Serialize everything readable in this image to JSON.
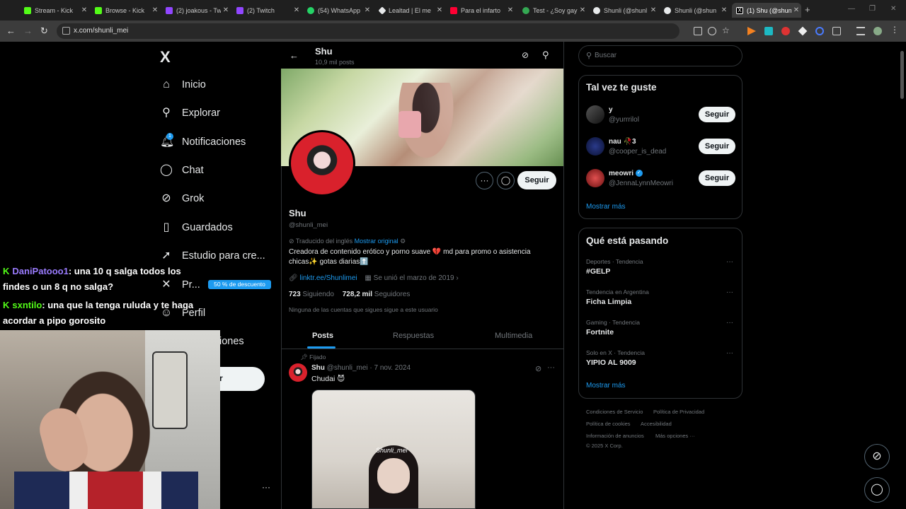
{
  "browser": {
    "tabs": [
      {
        "title": "Stream - Kick",
        "color": "#53fc18"
      },
      {
        "title": "Browse - Kick",
        "color": "#53fc18"
      },
      {
        "title": "(2) joakous - Tw",
        "color": "#9146ff"
      },
      {
        "title": "(2) Twitch",
        "color": "#9146ff"
      },
      {
        "title": "(54) WhatsApp",
        "color": "#25d366"
      },
      {
        "title": "Lealtad | El me",
        "color": "#e7e9ea"
      },
      {
        "title": "Para el infarto",
        "color": "#ff0033"
      },
      {
        "title": "Test - ¿Soy gay",
        "color": "#34a853"
      },
      {
        "title": "Shunli (@shunl",
        "color": "#e7e9ea"
      },
      {
        "title": "Shunli (@shun",
        "color": "#e7e9ea"
      },
      {
        "title": "(1) Shu (@shun",
        "color": "#e7e9ea"
      }
    ],
    "url": "x.com/shunli_mei"
  },
  "sidebar": {
    "logo": "X",
    "items": [
      {
        "label": "Inicio",
        "icon": "home-icon"
      },
      {
        "label": "Explorar",
        "icon": "search-icon"
      },
      {
        "label": "Notificaciones",
        "icon": "bell-icon",
        "badge": "1"
      },
      {
        "label": "Chat",
        "icon": "chat-icon"
      },
      {
        "label": "Grok",
        "icon": "grok-icon"
      },
      {
        "label": "Guardados",
        "icon": "bookmark-icon"
      },
      {
        "label": "Estudio para cre...",
        "icon": "rocket-icon"
      },
      {
        "label": "Pr...",
        "icon": "x-premium-icon"
      },
      {
        "label": "Perfil",
        "icon": "person-icon"
      },
      {
        "label": "iones",
        "icon": "more-icon"
      }
    ],
    "premium_badge": "50 % de descuento",
    "post_button": "r"
  },
  "profile": {
    "header_name": "Shu",
    "header_count": "10,9 mil posts",
    "name": "Shu",
    "handle": "@shunli_mei",
    "follow_label": "Seguir",
    "translated_label": "Traducido del inglés",
    "show_original": "Mostrar original",
    "bio_line1": "Creadora de contenido erótico y porno suave 💔 md para promo o asistencia",
    "bio_line2": "chicas✨ gotas diarias⬆️",
    "link": "linktr.ee/Shunlimei",
    "joined": "Se unió el marzo de 2019",
    "following_count": "723",
    "following_label": "Siguiendo",
    "followers_count": "728,2 mil",
    "followers_label": "Seguidores",
    "no_follow_note": "Ninguna de las cuentas que sigues sigue a este usuario",
    "tabs": [
      "Posts",
      "Respuestas",
      "Multimedia"
    ]
  },
  "post": {
    "pinned": "Fijado",
    "name": "Shu",
    "handle": "@shunli_mei",
    "date": "· 7 nov. 2024",
    "text": "Chudai 😈",
    "image_caption": "Shunli_mei"
  },
  "right": {
    "search_placeholder": "Buscar",
    "suggest_title": "Tal vez te guste",
    "suggestions": [
      {
        "name": "y",
        "handle": "@yurrrilol",
        "button": "Seguir",
        "color": "#3a3a3a"
      },
      {
        "name": "nau 🥀3",
        "handle": "@cooper_is_dead",
        "button": "Seguir",
        "color": "#2a3a8a"
      },
      {
        "name": "meowri",
        "handle": "@JennaLynnMeowri",
        "button": "Seguir",
        "color": "#a32a2a"
      }
    ],
    "show_more": "Mostrar más",
    "trends_title": "Qué está pasando",
    "trends": [
      {
        "meta": "Deportes · Tendencia",
        "name": "#GELP"
      },
      {
        "meta": "Tendencia en Argentina",
        "name": "Ficha Limpia"
      },
      {
        "meta": "Gaming · Tendencia",
        "name": "Fortnite"
      },
      {
        "meta": "Solo en X · Tendencia",
        "name": "YIPIO AL 9009"
      }
    ],
    "trends_more": "Mostrar más",
    "footer": [
      "Condiciones de Servicio",
      "Política de Privacidad",
      "Política de cookies",
      "Accesibilidad",
      "Información de anuncios",
      "Más opciones ···",
      "© 2025 X Corp."
    ]
  },
  "stream_chat": [
    {
      "user": "DaniPatooo1",
      "line1": ": una 10 q salga todos los",
      "line2": "findes o un 8 q no salga?"
    },
    {
      "user": "sxntilo",
      "line1": ": una que la tenga ruluda y te haga",
      "line2": "acordar a pipo gorosito"
    }
  ]
}
